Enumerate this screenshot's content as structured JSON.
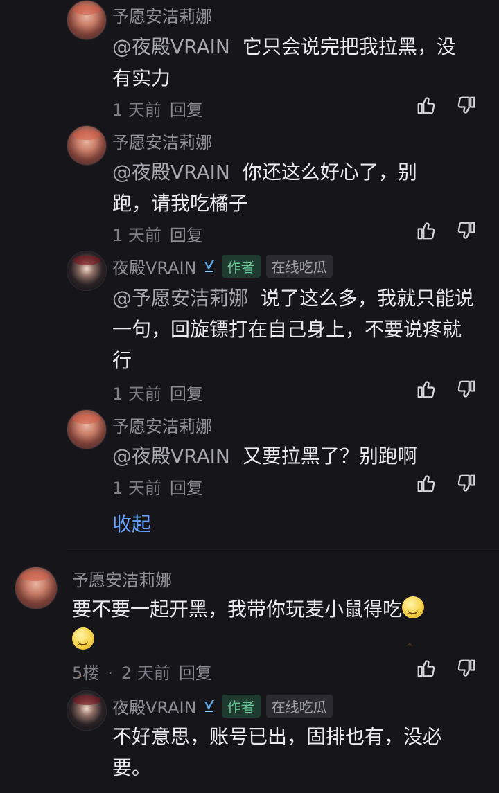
{
  "comments": [
    {
      "username": "予愿安洁莉娜",
      "mention": "@夜殿VRAIN",
      "text": "它只会说完把我拉黑，没有实力",
      "time": "1 天前",
      "reply": "回复"
    },
    {
      "username": "予愿安洁莉娜",
      "mention": "@夜殿VRAIN",
      "text": "你还这么好心了，别跑，请我吃橘子",
      "time": "1 天前",
      "reply": "回复"
    },
    {
      "username": "夜殿VRAIN",
      "author_badge": "作者",
      "online_badge": "在线吃瓜",
      "mention": "@予愿安洁莉娜",
      "text": "说了这么多，我就只能说一句，回旋镖打在自己身上，不要说疼就行",
      "time": "1 天前",
      "reply": "回复"
    },
    {
      "username": "予愿安洁莉娜",
      "mention": "@夜殿VRAIN",
      "text": "又要拉黑了？别跑啊",
      "time": "1 天前",
      "reply": "回复"
    }
  ],
  "collapse_label": "收起",
  "floor_comment": {
    "username": "予愿安洁莉娜",
    "text": "要不要一起开黑，我带你玩麦小鼠得吃",
    "floor": "5楼",
    "separator": "·",
    "time": "2 天前",
    "reply": "回复"
  },
  "floor_reply": {
    "username": "夜殿VRAIN",
    "author_badge": "作者",
    "online_badge": "在线吃瓜",
    "text": "不好意思，账号已出，固排也有，没必要。"
  },
  "icons": {
    "like": "thumb-up-icon",
    "dislike": "thumb-down-icon",
    "verified": "verified-icon",
    "emoji": "smile-emoji-icon"
  },
  "colors": {
    "background": "#16161a",
    "link": "#6aa2ff",
    "author_badge": "#6ac495"
  }
}
